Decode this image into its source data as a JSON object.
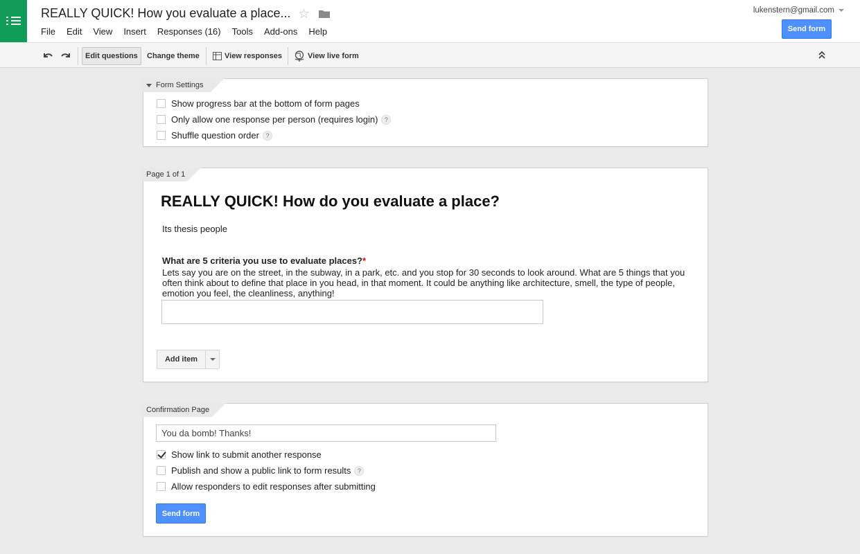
{
  "header": {
    "title": "REALLY QUICK! How you evaluate a place...",
    "account": "lukenstern@gmail.com",
    "send_form": "Send form",
    "menu": [
      "File",
      "Edit",
      "View",
      "Insert",
      "Responses (16)",
      "Tools",
      "Add-ons",
      "Help"
    ]
  },
  "icons": {
    "app_menu": "grid-list-icon",
    "star": "star-icon",
    "folder": "folder-icon",
    "undo": "undo-icon",
    "redo": "redo-icon",
    "responses": "table-icon",
    "live_form": "globe-icon",
    "collapse": "double-chevron-up-icon"
  },
  "toolbar": {
    "edit_questions": "Edit questions",
    "change_theme": "Change theme",
    "view_responses": "View responses",
    "view_live_form": "View live form"
  },
  "form_settings": {
    "tab": "Form Settings",
    "options": [
      {
        "label": "Show progress bar at the bottom of form pages",
        "checked": false
      },
      {
        "label": "Only allow one response per person (requires login)",
        "checked": false
      },
      {
        "label": "Shuffle question order",
        "checked": false
      }
    ]
  },
  "page": {
    "tab": "Page 1 of 1",
    "title": "REALLY QUICK! How do you evaluate a place?",
    "description": "Its thesis people",
    "question": {
      "title": "What are 5 criteria you use to evaluate places?",
      "required_mark": "*",
      "help": "Lets say you are on the street, in the subway, in a park, etc. and you stop for 30 seconds to look around. What are 5 things that you often think about to define that place in you head, in that moment. It could be anything like architecture, smell, the type of people, emotion you feel, the cleanliness, anything!",
      "answer": ""
    },
    "add_item": "Add item"
  },
  "confirmation": {
    "tab": "Confirmation Page",
    "message": "You da bomb! Thanks!",
    "options": [
      {
        "label": "Show link to submit another response",
        "checked": true
      },
      {
        "label": "Publish and show a public link to form results",
        "checked": false
      },
      {
        "label": "Allow responders to edit responses after submitting",
        "checked": false
      }
    ],
    "send_form": "Send form"
  },
  "help_glyph": "?",
  "colors": {
    "brand_green": "#0f9d58",
    "button_blue": "#4d90fe",
    "required_red": "#cc1111"
  }
}
